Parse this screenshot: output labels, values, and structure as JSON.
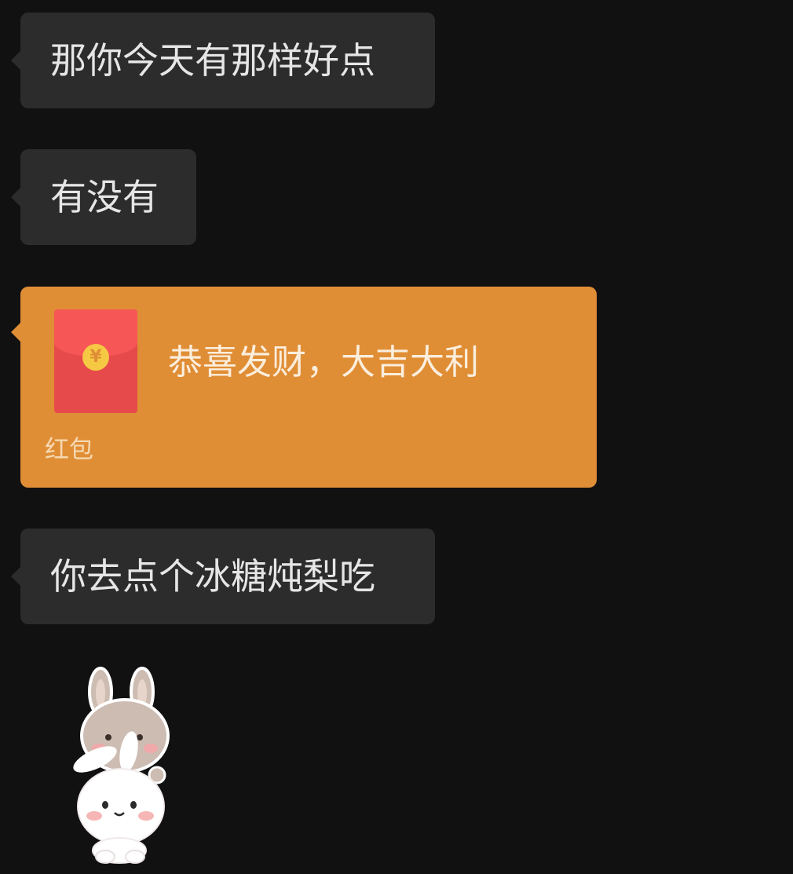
{
  "chat": {
    "messages": [
      {
        "type": "text",
        "text": "那你今天有那样好点"
      },
      {
        "type": "text",
        "text": "有没有"
      },
      {
        "type": "red_packet",
        "title": "恭喜发财，大吉大利",
        "label": "红包",
        "coin_symbol": "¥"
      },
      {
        "type": "text",
        "text": "你去点个冰糖炖梨吃"
      },
      {
        "type": "sticker",
        "icon": "bunny-sticker-icon"
      }
    ]
  },
  "colors": {
    "background": "#111111",
    "bubble": "#2c2c2c",
    "bubble_text": "#e6e6e6",
    "red_packet": "#e08e36",
    "envelope": "#e64a4a",
    "coin": "#f6c944"
  }
}
